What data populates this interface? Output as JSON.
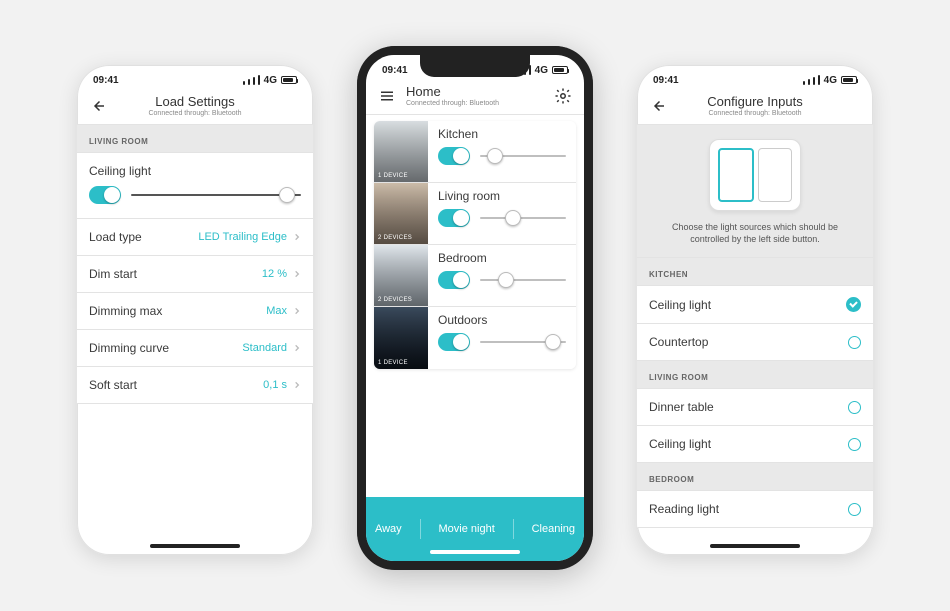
{
  "status": {
    "time": "09:41",
    "net": "4G"
  },
  "left": {
    "title": "Load Settings",
    "subtitle": "Connected through: Bluetooth",
    "section": "LIVING ROOM",
    "device": "Ceiling light",
    "slider_value": 0.92,
    "rows": [
      {
        "label": "Load type",
        "value": "LED Trailing Edge"
      },
      {
        "label": "Dim start",
        "value": "12 %"
      },
      {
        "label": "Dimming max",
        "value": "Max"
      },
      {
        "label": "Dimming curve",
        "value": "Standard"
      },
      {
        "label": "Soft start",
        "value": "0,1 s"
      }
    ]
  },
  "center": {
    "title": "Home",
    "subtitle": "Connected through: Bluetooth",
    "rooms": [
      {
        "name": "Kitchen",
        "devices": "1 DEVICE",
        "slider": 0.18
      },
      {
        "name": "Living room",
        "devices": "2 DEVICES",
        "slider": 0.38
      },
      {
        "name": "Bedroom",
        "devices": "2 DEVICES",
        "slider": 0.3
      },
      {
        "name": "Outdoors",
        "devices": "1 DEVICE",
        "slider": 0.85
      }
    ],
    "scenes": [
      "Away",
      "Movie night",
      "Cleaning"
    ]
  },
  "right": {
    "title": "Configure Inputs",
    "subtitle": "Connected through: Bluetooth",
    "description": "Choose the light sources which should be controlled by the left side button.",
    "sections": [
      {
        "label": "KITCHEN",
        "items": [
          {
            "name": "Ceiling light",
            "checked": true
          },
          {
            "name": "Countertop",
            "checked": false
          }
        ]
      },
      {
        "label": "LIVING ROOM",
        "items": [
          {
            "name": "Dinner table",
            "checked": false
          },
          {
            "name": "Ceiling light",
            "checked": false
          }
        ]
      },
      {
        "label": "BEDROOM",
        "items": [
          {
            "name": "Reading light",
            "checked": false
          }
        ]
      }
    ]
  },
  "colors": {
    "accent": "#2cbec8"
  }
}
